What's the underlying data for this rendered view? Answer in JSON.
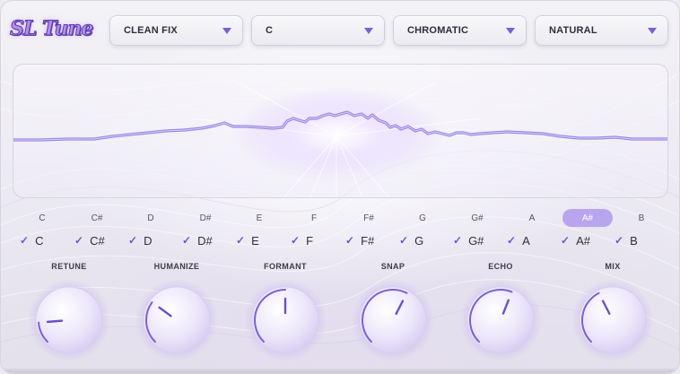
{
  "app": {
    "logo": "SL Tune"
  },
  "dropdowns": [
    {
      "label": "CLEAN FIX"
    },
    {
      "label": "C"
    },
    {
      "label": "CHROMATIC"
    },
    {
      "label": "NATURAL"
    }
  ],
  "notes": {
    "labels": [
      "C",
      "C#",
      "D",
      "D#",
      "E",
      "F",
      "F#",
      "G",
      "G#",
      "A",
      "A#",
      "B"
    ],
    "highlighted": "A#",
    "checks": [
      {
        "label": "C",
        "checked": true
      },
      {
        "label": "C#",
        "checked": true
      },
      {
        "label": "D",
        "checked": true
      },
      {
        "label": "D#",
        "checked": true
      },
      {
        "label": "E",
        "checked": true
      },
      {
        "label": "F",
        "checked": true
      },
      {
        "label": "F#",
        "checked": true
      },
      {
        "label": "G",
        "checked": true
      },
      {
        "label": "G#",
        "checked": true
      },
      {
        "label": "A",
        "checked": true
      },
      {
        "label": "A#",
        "checked": true
      },
      {
        "label": "B",
        "checked": true
      }
    ]
  },
  "knobs": [
    {
      "label": "RETUNE",
      "value": 0.15
    },
    {
      "label": "HUMANIZE",
      "value": 0.3
    },
    {
      "label": "FORMANT",
      "value": 0.5
    },
    {
      "label": "SNAP",
      "value": 0.6
    },
    {
      "label": "ECHO",
      "value": 0.58
    },
    {
      "label": "MIX",
      "value": 0.4
    }
  ],
  "colors": {
    "accent": "#7a5fd6",
    "accent_light": "#b9a5ef",
    "waveform": "#8c74e0",
    "text": "#2e2e3a"
  },
  "icons": {
    "dropdown": "chevron-down-icon",
    "check": "check-icon"
  }
}
